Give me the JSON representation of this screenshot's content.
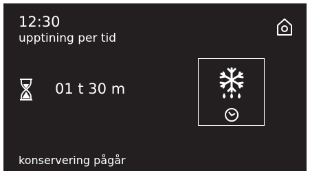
{
  "header": {
    "time": "12:30",
    "program": "upptining per tid"
  },
  "timer": {
    "icon": "hourglass-icon",
    "duration": "01 t 30 m"
  },
  "mode": {
    "icons": [
      "snowflake-icon",
      "water-drops-icon",
      "clock-icon"
    ]
  },
  "status": {
    "text": "konservering pågår"
  },
  "home": {
    "icon": "home-icon"
  },
  "colors": {
    "background": "#231f20",
    "foreground": "#ffffff"
  }
}
